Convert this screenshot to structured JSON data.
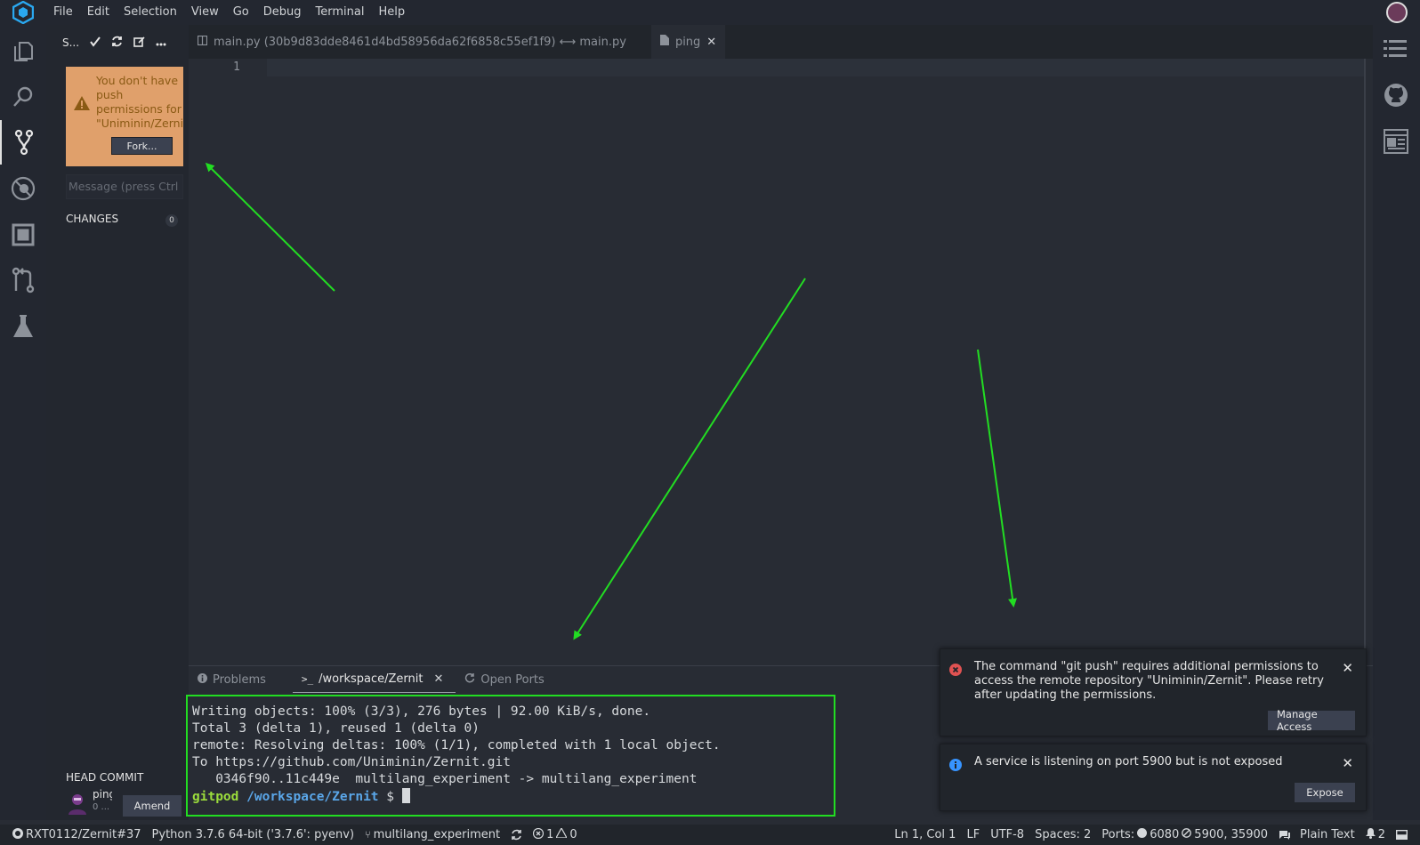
{
  "menu": [
    "File",
    "Edit",
    "Selection",
    "View",
    "Go",
    "Debug",
    "Terminal",
    "Help"
  ],
  "side": {
    "title": "S...",
    "warning_text": "You don't have\npush\npermissions for\n\"Uniminin/Zernit\"",
    "fork_label": "Fork...",
    "message_placeholder": "Message (press Ctrl",
    "changes_label": "CHANGES",
    "changes_count": "0",
    "head_commit_label": "HEAD COMMIT",
    "commit_name": "ping",
    "commit_sub": "0 ...",
    "amend_label": "Amend"
  },
  "tabs": [
    {
      "label": "main.py (30b9d83dde8461d4bd58956da62f6858c55ef1f9) ⟷ main.py",
      "active": false
    },
    {
      "label": "ping",
      "active": true
    }
  ],
  "editor": {
    "line_number": "1"
  },
  "panel": {
    "tabs": [
      {
        "label": "Problems",
        "icon": "info-icon"
      },
      {
        "label": "/workspace/Zernit",
        "icon": "terminal-icon"
      },
      {
        "label": "Open Ports",
        "icon": "refresh-icon"
      }
    ],
    "terminal": {
      "lines": [
        "Writing objects: 100% (3/3), 276 bytes | 92.00 KiB/s, done.",
        "Total 3 (delta 1), reused 1 (delta 0)",
        "remote: Resolving deltas: 100% (1/1), completed with 1 local object.",
        "To https://github.com/Uniminin/Zernit.git",
        "   0346f90..11c449e  multilang_experiment -> multilang_experiment"
      ],
      "prompt_user": "gitpod",
      "prompt_path": "/workspace/Zernit",
      "prompt_symbol": "$"
    }
  },
  "notifications": [
    {
      "type": "error",
      "text": "The command \"git push\" requires additional permissions to access the remote repository \"Uniminin/Zernit\". Please retry after updating the permissions.",
      "button": "Manage Access"
    },
    {
      "type": "info",
      "text": "A service is listening on port 5900 but is not exposed",
      "button": "Expose"
    }
  ],
  "status": {
    "repo": "RXT0112/Zernit#37",
    "python": "Python 3.7.6 64-bit ('3.7.6': pyenv)",
    "branch": "multilang_experiment",
    "errors": "1",
    "warnings": "0",
    "cursor": "Ln 1, Col 1",
    "eol": "LF",
    "encoding": "UTF-8",
    "spaces": "Spaces: 2",
    "ports_label": "Ports:",
    "port_open": "6080",
    "port_closed": "5900, 35900",
    "language": "Plain Text",
    "notifications_count": "2"
  },
  "colors": {
    "accent_green": "#22dd22",
    "warning_bg": "#e0a06b",
    "error_red": "#e05252",
    "info_blue": "#3794ff"
  }
}
